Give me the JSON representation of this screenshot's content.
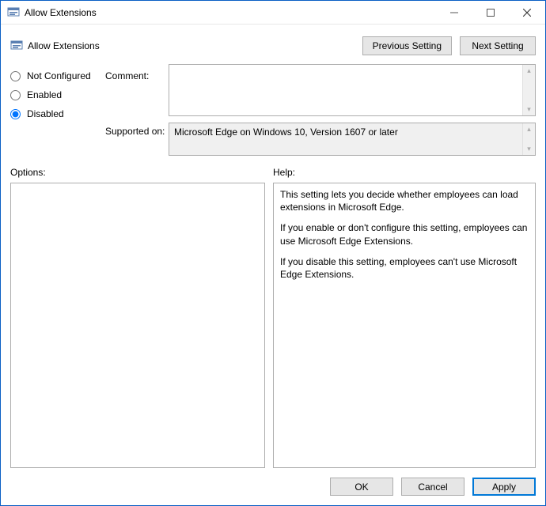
{
  "window": {
    "title": "Allow Extensions"
  },
  "header": {
    "policy_name": "Allow Extensions"
  },
  "nav": {
    "previous": "Previous Setting",
    "next": "Next Setting"
  },
  "radio": {
    "not_configured": "Not Configured",
    "enabled": "Enabled",
    "disabled": "Disabled",
    "selected": "disabled"
  },
  "labels": {
    "comment": "Comment:",
    "supported": "Supported on:",
    "options": "Options:",
    "help": "Help:"
  },
  "fields": {
    "comment": "",
    "supported": "Microsoft Edge on Windows 10, Version 1607 or later"
  },
  "help": {
    "p1": "This setting lets you decide whether employees can load extensions in Microsoft Edge.",
    "p2": "If you enable or don't configure this setting, employees can use Microsoft Edge Extensions.",
    "p3": "If you disable this setting, employees can't use Microsoft Edge Extensions."
  },
  "buttons": {
    "ok": "OK",
    "cancel": "Cancel",
    "apply": "Apply"
  }
}
